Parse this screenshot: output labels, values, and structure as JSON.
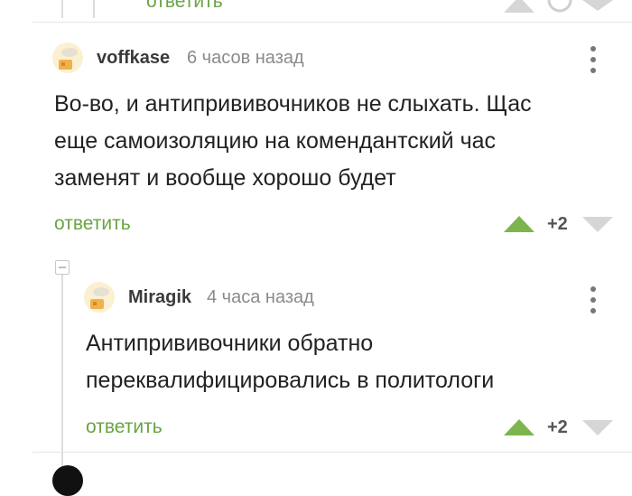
{
  "colors": {
    "accent": "#6aa344",
    "upvote": "#7cb54e",
    "downvote": "#d6d6d6",
    "text": "#222222",
    "muted": "#8a8a8a"
  },
  "top_partial": {
    "reply_label": "ответить"
  },
  "comments": [
    {
      "username": "voffkase",
      "time": "6 часов назад",
      "lines": [
        "Во-во, и антипрививочников не слыхать. Щас",
        "еще самоизоляцию на комендантский час",
        "заменят и вообще хорошо будет"
      ],
      "reply_label": "ответить",
      "score": "+2",
      "avatar_icon": "pikabu-default-avatar-icon"
    },
    {
      "username": "Miragik",
      "time": "4 часа назад",
      "lines": [
        "Антипрививочники обратно",
        "переквалифицировались в политологи"
      ],
      "reply_label": "ответить",
      "score": "+2",
      "avatar_icon": "pikabu-default-avatar-icon"
    }
  ]
}
